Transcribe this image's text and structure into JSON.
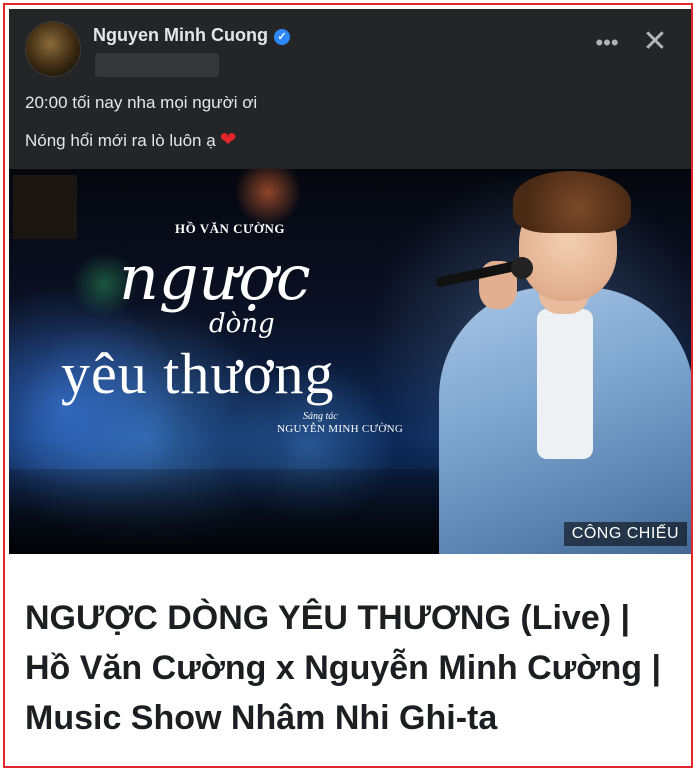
{
  "post": {
    "author": "Nguyen Minh Cuong",
    "verified": true,
    "line1": "20:00 tối nay nha mọi người ơi",
    "line2": "Nóng hổi mới ra lò luôn ạ",
    "heart_emoji": "❤",
    "more_icon": "more-horizontal-icon",
    "close_icon": "close-icon",
    "more_glyph": "•••",
    "close_glyph": "✕"
  },
  "thumbnail": {
    "singer": "HỒ VĂN CƯỜNG",
    "title_line1": "ngược",
    "title_line2": "dòng",
    "title_line3": "yêu thương",
    "composer_label": "Sáng tác",
    "composer_name": "NGUYỄN MINH CƯỜNG",
    "badge": "CÔNG CHIẾU"
  },
  "headline": "NGƯỢC DÒNG YÊU THƯƠNG (Live) | Hồ Văn Cường x Nguyễn Minh Cường | Music Show Nhâm Nhi Ghi-ta",
  "colors": {
    "frame_border": "#e0262b",
    "post_bg": "#242526",
    "post_text": "#e4e6eb",
    "verified_badge": "#2d88ff",
    "heart": "#e4252b",
    "headline_text": "#1c1e21"
  }
}
